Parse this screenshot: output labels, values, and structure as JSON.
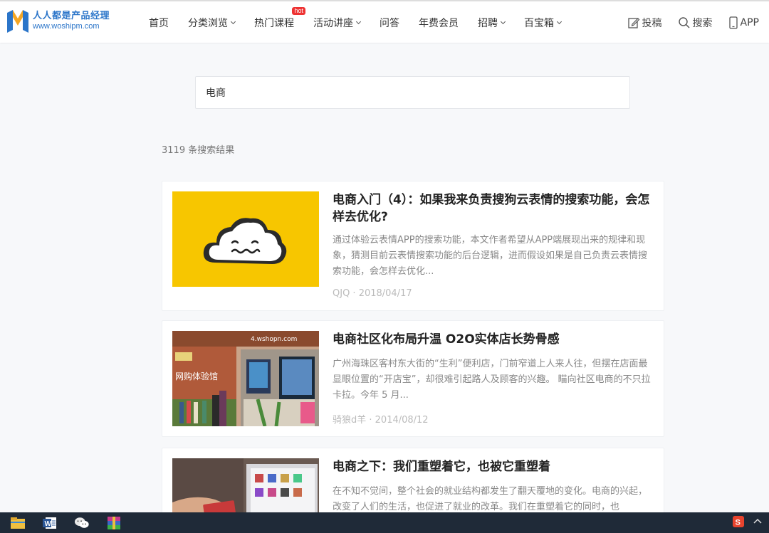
{
  "header": {
    "logo": {
      "cn": "人人都是产品经理",
      "en": "www.woshipm.com"
    },
    "nav": [
      {
        "label": "首页",
        "dropdown": false
      },
      {
        "label": "分类浏览",
        "dropdown": true
      },
      {
        "label": "热门课程",
        "dropdown": false,
        "badge": "hot"
      },
      {
        "label": "活动讲座",
        "dropdown": true
      },
      {
        "label": "问答",
        "dropdown": false
      },
      {
        "label": "年费会员",
        "dropdown": false
      },
      {
        "label": "招聘",
        "dropdown": true
      },
      {
        "label": "百宝箱",
        "dropdown": true
      }
    ],
    "tools": {
      "submit": "投稿",
      "search": "搜索",
      "app": "APP"
    }
  },
  "search": {
    "value": "电商"
  },
  "results": {
    "count_text": "3119 条搜索结果",
    "items": [
      {
        "title": "电商入门（4）：如果我来负责搜狗云表情的搜索功能，会怎样去优化?",
        "desc": "通过体验云表情APP的搜索功能，本文作者希望从APP端展现出来的规律和现象，猜测目前云表情搜索功能的后台逻辑，进而假设如果是自己负责云表情搜索功能，会怎样去优化...",
        "meta": "QJQ · 2018/04/17"
      },
      {
        "title": "电商社区化布局升温 O2O实体店长势骨感",
        "desc": "广州海珠区客村东大街的“生利”便利店，门前窄道上人来人往，但摆在店面最显眼位置的“开店宝”，却很难引起路人及顾客的兴趣。 瞄向社区电商的不只拉卡拉。今年 5 月...",
        "meta": "骑狼d羊 · 2014/08/12"
      },
      {
        "title": "电商之下：我们重塑着它，也被它重塑着",
        "desc": "在不知不觉间，整个社会的就业结构都发生了翻天覆地的变化。电商的兴起，改变了人们的生活，也促进了就业的改革。我们在重塑着它的同时，也",
        "meta": ""
      }
    ]
  },
  "thumb_text": {
    "shop_sign": "网购体验馆",
    "shop_url": "4.wshopn.com"
  },
  "colors": {
    "accent": "#2b75c9",
    "hot": "#e33333",
    "cloud_bg": "#f7c600",
    "taskbar": "#1f2a38"
  }
}
